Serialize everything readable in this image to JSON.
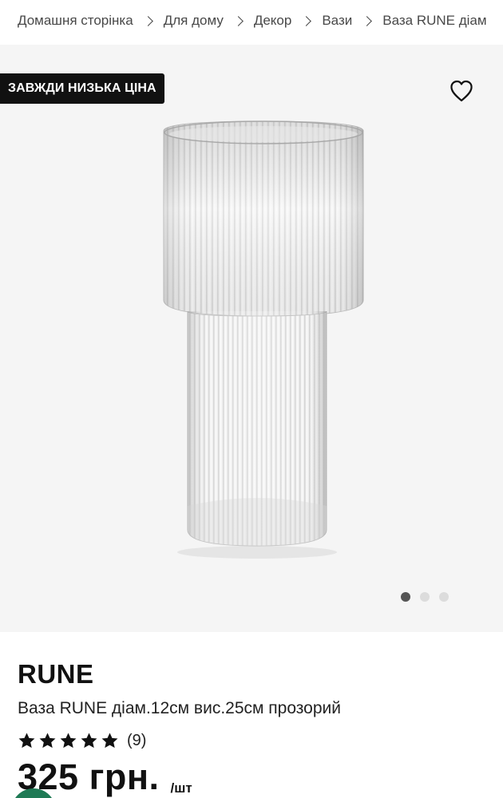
{
  "breadcrumb": {
    "items": [
      "Домашня сторінка",
      "Для дому",
      "Декор",
      "Вази",
      "Ваза RUNE діам"
    ]
  },
  "hero": {
    "badge": "ЗАВЖДИ НИЗЬКА ЦІНА",
    "favorite_icon": "heart-outline-icon",
    "carousel": {
      "pages": 3,
      "active_index": 0
    }
  },
  "product": {
    "name": "RUNE",
    "description": "Ваза RUNE діам.12см вис.25см прозорий",
    "rating": {
      "stars": 5,
      "count": "(9)"
    },
    "price": "325 грн.",
    "unit": "/шт"
  },
  "colors": {
    "badge_bg": "#111111",
    "hero_bg": "#f5f5f5",
    "dot_active": "#555555",
    "dot_inactive": "#dcdcdc",
    "fab": "#1f7a55"
  }
}
